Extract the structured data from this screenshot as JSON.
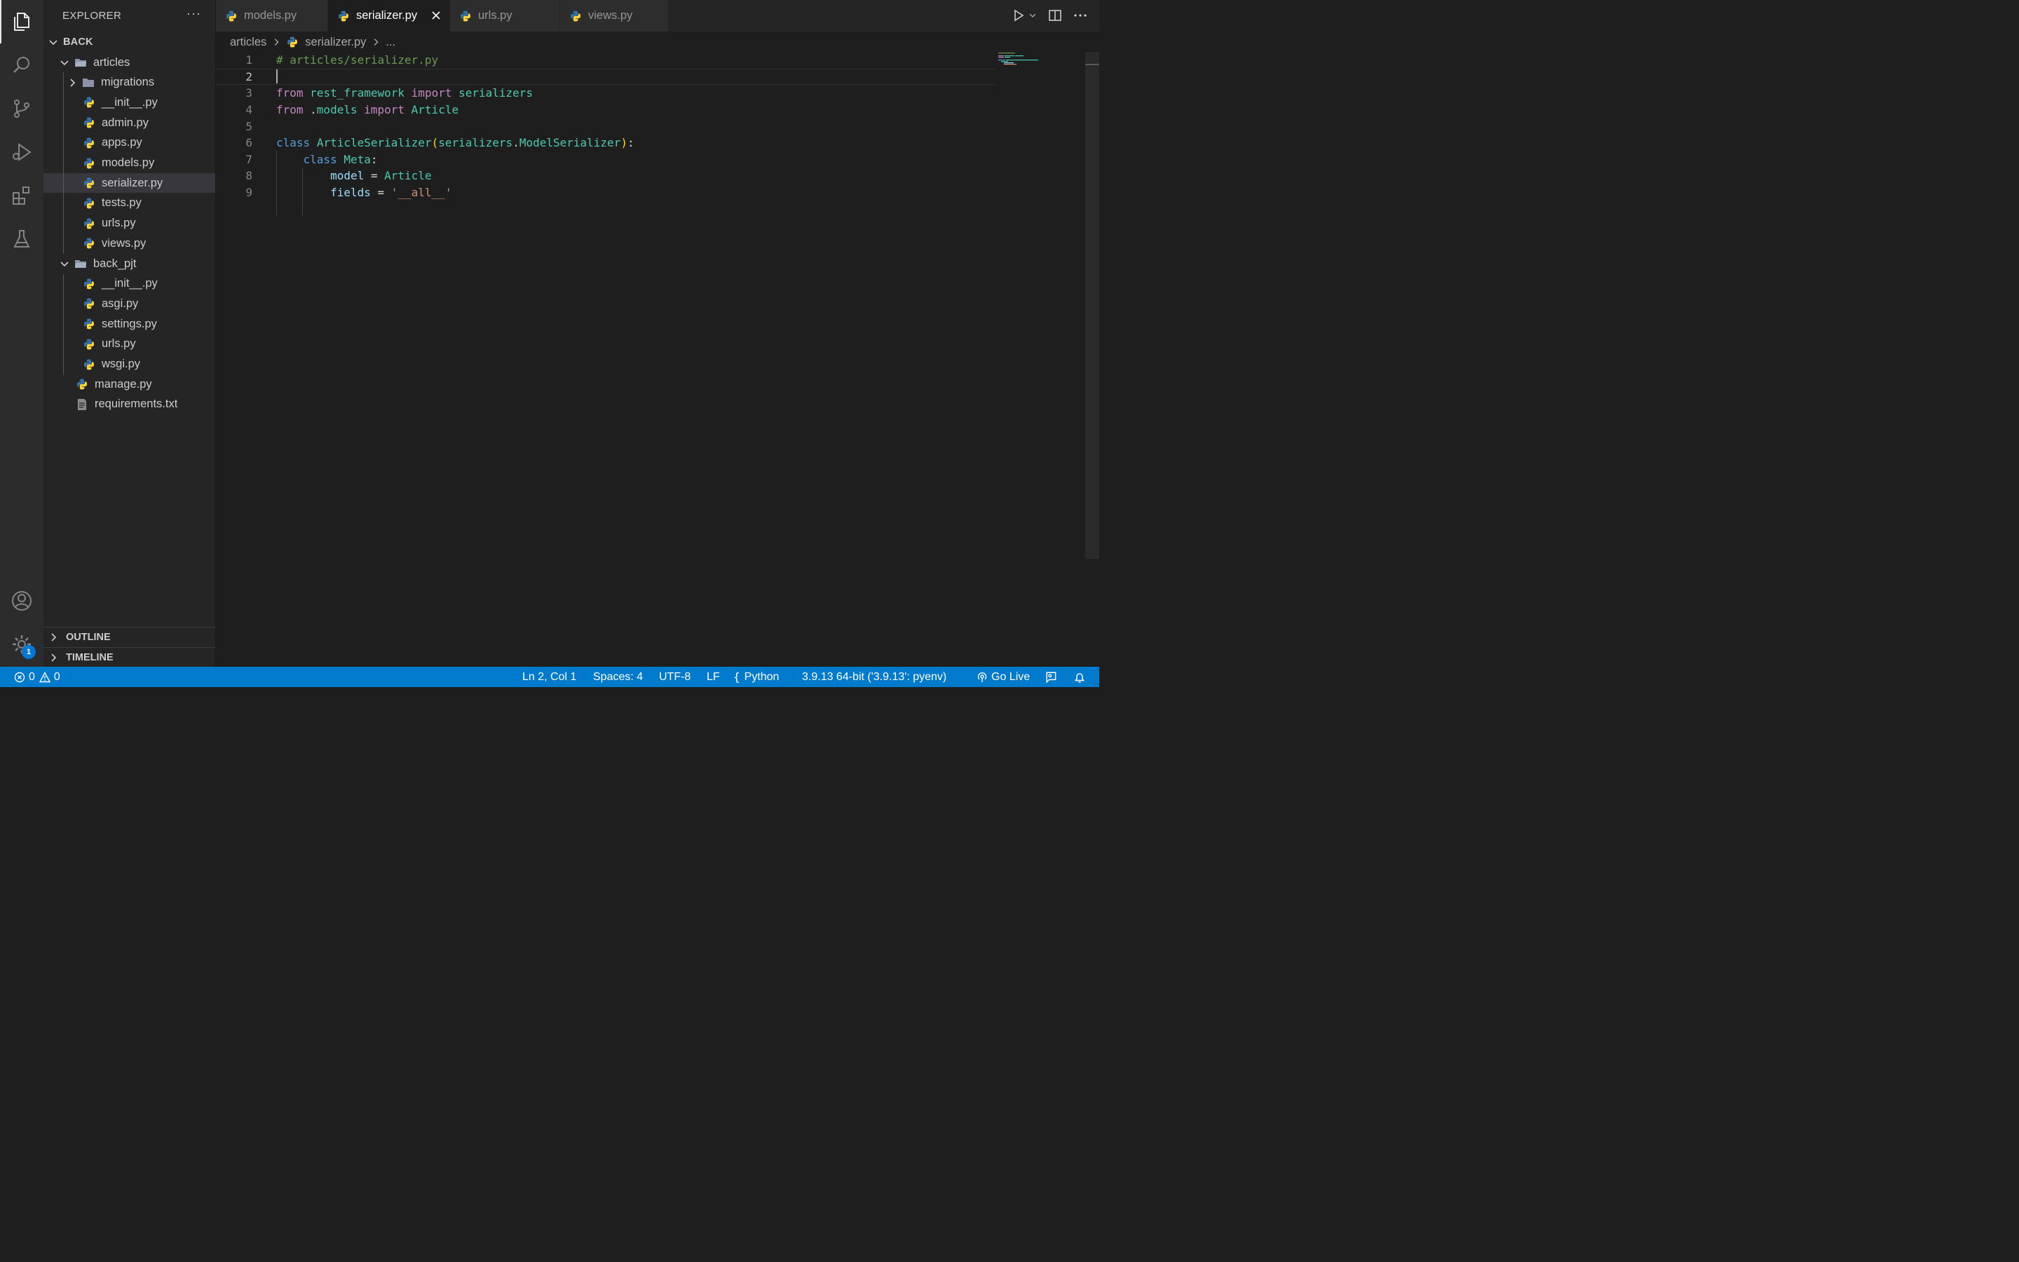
{
  "sidebar": {
    "title": "EXPLORER",
    "root": "BACK",
    "items": [
      {
        "label": "articles",
        "type": "folder-open",
        "depth": 1
      },
      {
        "label": "migrations",
        "type": "folder-closed",
        "depth": 2
      },
      {
        "label": "__init__.py",
        "type": "python",
        "depth": 2
      },
      {
        "label": "admin.py",
        "type": "python",
        "depth": 2
      },
      {
        "label": "apps.py",
        "type": "python",
        "depth": 2
      },
      {
        "label": "models.py",
        "type": "python",
        "depth": 2
      },
      {
        "label": "serializer.py",
        "type": "python",
        "depth": 2
      },
      {
        "label": "tests.py",
        "type": "python",
        "depth": 2
      },
      {
        "label": "urls.py",
        "type": "python",
        "depth": 2
      },
      {
        "label": "views.py",
        "type": "python",
        "depth": 2
      },
      {
        "label": "back_pjt",
        "type": "folder-open",
        "depth": 1
      },
      {
        "label": "__init__.py",
        "type": "python",
        "depth": 2
      },
      {
        "label": "asgi.py",
        "type": "python",
        "depth": 2
      },
      {
        "label": "settings.py",
        "type": "python",
        "depth": 2
      },
      {
        "label": "urls.py",
        "type": "python",
        "depth": 2
      },
      {
        "label": "wsgi.py",
        "type": "python",
        "depth": 2
      },
      {
        "label": "manage.py",
        "type": "python",
        "depth": 1
      },
      {
        "label": "requirements.txt",
        "type": "text",
        "depth": 1
      }
    ],
    "outline": "OUTLINE",
    "timeline": "TIMELINE"
  },
  "activity": {
    "icons": [
      "files-icon",
      "search-icon",
      "source-control-icon",
      "run-debug-icon",
      "extensions-icon",
      "testing-icon",
      "account-icon",
      "settings-gear-icon"
    ],
    "settings_badge": "1"
  },
  "tabs": [
    {
      "label": "models.py"
    },
    {
      "label": "serializer.py"
    },
    {
      "label": "urls.py"
    },
    {
      "label": "views.py"
    }
  ],
  "breadcrumb": {
    "folder": "articles",
    "file": "serializer.py",
    "more": "..."
  },
  "editor": {
    "line_numbers": [
      "1",
      "2",
      "3",
      "4",
      "5",
      "6",
      "7",
      "8",
      "9"
    ],
    "lines": [
      [
        {
          "t": "# articles/serializer.py",
          "c": "comment"
        }
      ],
      [],
      [
        {
          "t": "from",
          "c": "kw"
        },
        {
          "t": " ",
          "c": "plain"
        },
        {
          "t": "rest_framework",
          "c": "type"
        },
        {
          "t": " ",
          "c": "plain"
        },
        {
          "t": "import",
          "c": "kw"
        },
        {
          "t": " ",
          "c": "plain"
        },
        {
          "t": "serializers",
          "c": "type"
        }
      ],
      [
        {
          "t": "from",
          "c": "kw"
        },
        {
          "t": " .",
          "c": "plain"
        },
        {
          "t": "models",
          "c": "type"
        },
        {
          "t": " ",
          "c": "plain"
        },
        {
          "t": "import",
          "c": "kw"
        },
        {
          "t": " ",
          "c": "plain"
        },
        {
          "t": "Article",
          "c": "type"
        }
      ],
      [],
      [
        {
          "t": "class",
          "c": "class"
        },
        {
          "t": " ",
          "c": "plain"
        },
        {
          "t": "ArticleSerializer",
          "c": "type"
        },
        {
          "t": "(",
          "c": "paren"
        },
        {
          "t": "serializers",
          "c": "type"
        },
        {
          "t": ".",
          "c": "plain"
        },
        {
          "t": "ModelSerializer",
          "c": "type"
        },
        {
          "t": ")",
          "c": "paren"
        },
        {
          "t": ":",
          "c": "plain"
        }
      ],
      [
        {
          "t": "    ",
          "c": "plain"
        },
        {
          "t": "class",
          "c": "class"
        },
        {
          "t": " ",
          "c": "plain"
        },
        {
          "t": "Meta",
          "c": "type"
        },
        {
          "t": ":",
          "c": "plain"
        }
      ],
      [
        {
          "t": "        ",
          "c": "plain"
        },
        {
          "t": "model",
          "c": "var"
        },
        {
          "t": " = ",
          "c": "plain"
        },
        {
          "t": "Article",
          "c": "type"
        }
      ],
      [
        {
          "t": "        ",
          "c": "plain"
        },
        {
          "t": "fields",
          "c": "var"
        },
        {
          "t": " = ",
          "c": "plain"
        },
        {
          "t": "'__all__'",
          "c": "str"
        }
      ]
    ]
  },
  "statusbar": {
    "errors": "0",
    "warnings": "0",
    "position": "Ln 2, Col 1",
    "spaces": "Spaces: 4",
    "encoding": "UTF-8",
    "eol": "LF",
    "language": "Python",
    "interpreter": "3.9.13 64-bit ('3.9.13': pyenv)",
    "golive": "Go Live"
  },
  "colors": {
    "statusbar": "#007acc",
    "python_blue": "#3572A5",
    "python_yellow": "#FFD43B"
  }
}
